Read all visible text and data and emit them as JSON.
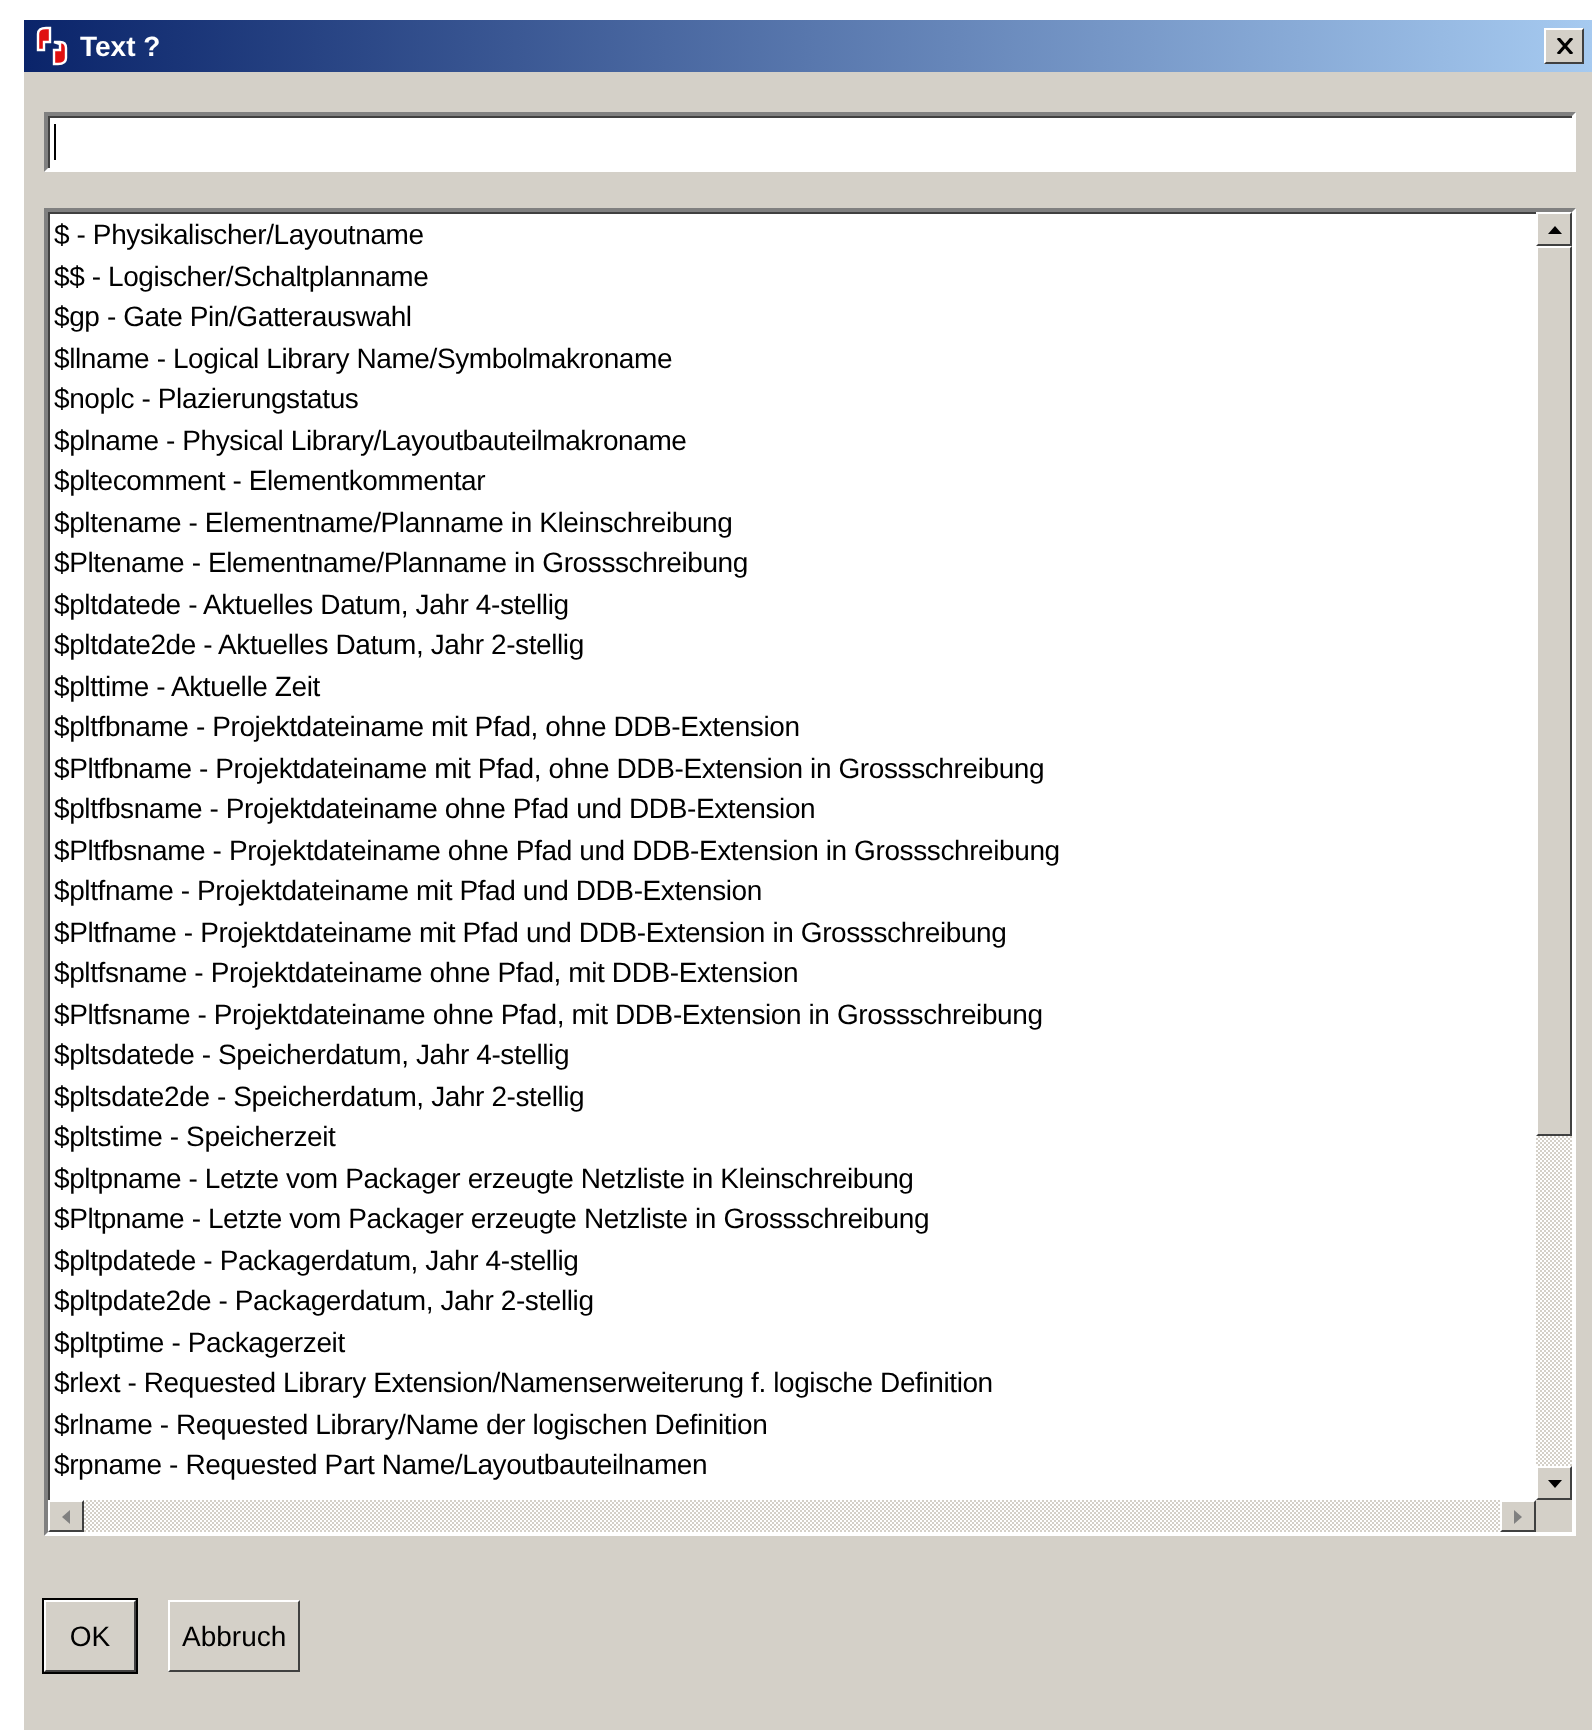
{
  "window": {
    "title": "Text ?"
  },
  "list": {
    "items": [
      "$ - Physikalischer/Layoutname",
      "$$ - Logischer/Schaltplanname",
      "$gp - Gate Pin/Gatterauswahl",
      "$llname - Logical Library Name/Symbolmakroname",
      "$noplc - Plazierungstatus",
      "$plname - Physical Library/Layoutbauteilmakroname",
      "$pltecomment - Elementkommentar",
      "$pltename - Elementname/Planname in Kleinschreibung",
      "$Pltename - Elementname/Planname in Grossschreibung",
      "$pltdatede - Aktuelles Datum, Jahr 4-stellig",
      "$pltdate2de - Aktuelles Datum, Jahr 2-stellig",
      "$plttime - Aktuelle Zeit",
      "$pltfbname - Projektdateiname mit Pfad, ohne DDB-Extension",
      "$Pltfbname - Projektdateiname mit Pfad, ohne DDB-Extension in Grossschreibung",
      "$pltfbsname - Projektdateiname ohne Pfad und DDB-Extension",
      "$Pltfbsname - Projektdateiname ohne Pfad und DDB-Extension in Grossschreibung",
      "$pltfname - Projektdateiname mit Pfad und DDB-Extension",
      "$Pltfname - Projektdateiname mit Pfad und DDB-Extension in Grossschreibung",
      "$pltfsname - Projektdateiname ohne Pfad, mit DDB-Extension",
      "$Pltfsname - Projektdateiname ohne Pfad, mit DDB-Extension in Grossschreibung",
      "$pltsdatede - Speicherdatum, Jahr 4-stellig",
      "$pltsdate2de - Speicherdatum, Jahr 2-stellig",
      "$pltstime - Speicherzeit",
      "$pltpname - Letzte vom Packager erzeugte Netzliste in Kleinschreibung",
      "$Pltpname - Letzte vom Packager erzeugte Netzliste in Grossschreibung",
      "$pltpdatede - Packagerdatum, Jahr 4-stellig",
      "$pltpdate2de - Packagerdatum, Jahr 2-stellig",
      "$pltptime - Packagerzeit",
      "$rlext - Requested Library Extension/Namenserweiterung f. logische Definition",
      "$rlname - Requested Library/Name der logischen Definition",
      "$rpname - Requested Part Name/Layoutbauteilnamen"
    ]
  },
  "buttons": [
    {
      "label": "OK",
      "default": true
    },
    {
      "label": "Abbruch",
      "default": false
    }
  ]
}
